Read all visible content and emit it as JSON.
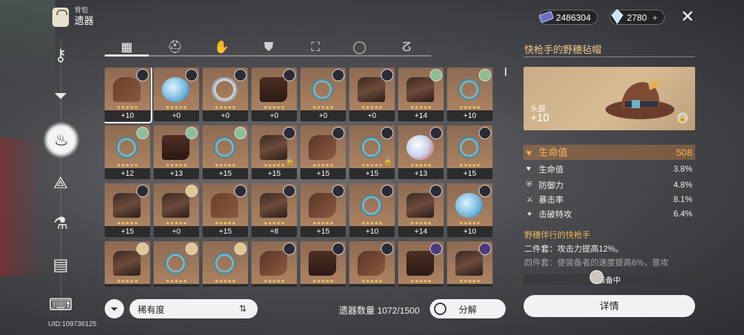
{
  "header": {
    "bag_label": "背包",
    "section_title": "遗器"
  },
  "currency": {
    "stellar_jade": "2486304",
    "fuel": "2780",
    "add_label": "+"
  },
  "uid_label": "UID:109736125",
  "sidebar": {
    "icons": [
      "key-icon",
      "funnel-icon",
      "relic-icon",
      "light-cone-icon",
      "flask-icon",
      "mission-card-icon",
      "ticket-icon"
    ]
  },
  "tabs": [
    "all-relics",
    "head",
    "hands",
    "body",
    "feet",
    "planar-sphere",
    "link-rope"
  ],
  "grid": {
    "items": [
      {
        "lvl": "+10",
        "badge": "dark",
        "art": "hat",
        "selected": true
      },
      {
        "lvl": "+0",
        "badge": "dark",
        "art": "orb"
      },
      {
        "lvl": "+0",
        "badge": "dark",
        "art": "ring"
      },
      {
        "lvl": "+0",
        "badge": "dark",
        "art": "boots"
      },
      {
        "lvl": "+0",
        "badge": "dark",
        "art": "rope"
      },
      {
        "lvl": "+0",
        "badge": "dark",
        "art": "coat"
      },
      {
        "lvl": "+14",
        "badge": "green",
        "art": "coat"
      },
      {
        "lvl": "+10",
        "badge": "green",
        "art": "rope"
      },
      {
        "lvl": "+12",
        "badge": "green",
        "art": "rope"
      },
      {
        "lvl": "+13",
        "badge": "green",
        "art": "boots"
      },
      {
        "lvl": "+15",
        "badge": "green",
        "art": "rope"
      },
      {
        "lvl": "+15",
        "badge": "dark",
        "art": "coat",
        "locked": true
      },
      {
        "lvl": "+15",
        "badge": "dark",
        "art": "gloves"
      },
      {
        "lvl": "+15",
        "badge": "dark",
        "art": "rope",
        "locked": true
      },
      {
        "lvl": "+13",
        "badge": "dark",
        "art": "orb2"
      },
      {
        "lvl": "+15",
        "badge": "dark",
        "art": "rope"
      },
      {
        "lvl": "+15",
        "badge": "dark",
        "art": "coat"
      },
      {
        "lvl": "+0",
        "badge": "blond",
        "art": "coat"
      },
      {
        "lvl": "+15",
        "badge": "dark",
        "art": "hat"
      },
      {
        "lvl": "+8",
        "badge": "dark",
        "art": "coat"
      },
      {
        "lvl": "+15",
        "badge": "dark",
        "art": "gloves"
      },
      {
        "lvl": "+10",
        "badge": "dark",
        "art": "rope"
      },
      {
        "lvl": "+14",
        "badge": "dark",
        "art": "coat"
      },
      {
        "lvl": "+10",
        "badge": "dark",
        "art": "orb"
      },
      {
        "lvl": "",
        "badge": "blond",
        "art": "coat"
      },
      {
        "lvl": "",
        "badge": "blond",
        "art": "rope"
      },
      {
        "lvl": "",
        "badge": "blond",
        "art": "rope"
      },
      {
        "lvl": "",
        "badge": "dark",
        "art": "gloves"
      },
      {
        "lvl": "",
        "badge": "dark",
        "art": "boots"
      },
      {
        "lvl": "",
        "badge": "dark",
        "art": "gloves"
      },
      {
        "lvl": "",
        "badge": "purple",
        "art": "boots"
      },
      {
        "lvl": "",
        "badge": "purple",
        "art": "coat"
      }
    ]
  },
  "bottom": {
    "sort_label": "稀有度",
    "count_label": "遗器数量 1072/1500",
    "salvage_label": "分解"
  },
  "panel": {
    "title": "快枪手的野穗毡帽",
    "slot": "头部",
    "level": "+10",
    "main_stat": {
      "label": "生命值",
      "value": "508"
    },
    "sub_stats": [
      {
        "label": "生命值",
        "value": "3.8%",
        "icon": "heart-icon"
      },
      {
        "label": "防御力",
        "value": "4.8%",
        "icon": "shield-icon"
      },
      {
        "label": "暴击率",
        "value": "8.1%",
        "icon": "crit-icon"
      },
      {
        "label": "击破特攻",
        "value": "6.4%",
        "icon": "break-icon"
      }
    ],
    "set_name": "野穗伴行的快枪手",
    "set_2pc": "二件套：攻击力提高12%。",
    "set_4pc": "四件套：使装备者的速度提高6%，普攻",
    "equipped_label": "装备中",
    "details_label": "详情"
  },
  "colors": {
    "accent": "#f0b25a",
    "card": "#a57d5e",
    "button": "#f2f2f2"
  }
}
